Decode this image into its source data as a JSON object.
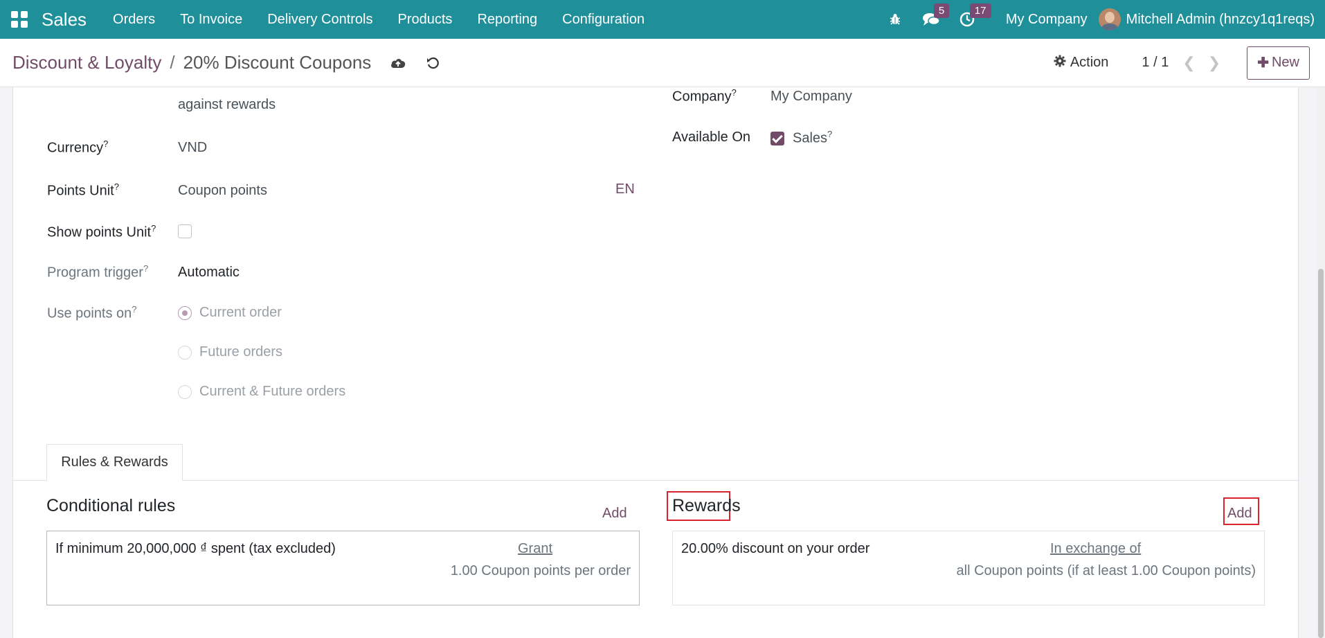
{
  "navbar": {
    "app_name": "Sales",
    "menu": [
      "Orders",
      "To Invoice",
      "Delivery Controls",
      "Products",
      "Reporting",
      "Configuration"
    ],
    "messages_count": "5",
    "activities_count": "17",
    "company": "My Company",
    "user": "Mitchell Admin (hnzcy1q1reqs)",
    "icons": [
      "apps-grid-icon",
      "bug-icon",
      "chat-icon",
      "clock-icon",
      "avatar"
    ]
  },
  "control_panel": {
    "breadcrumb_parent": "Discount & Loyalty",
    "breadcrumb_separator": "/",
    "breadcrumb_current": "20% Discount Coupons",
    "action_label": "Action",
    "pager": "1 / 1",
    "new_label": "New"
  },
  "form": {
    "truncated_text": "against rewards",
    "currency_label": "Currency",
    "currency_value": "VND",
    "points_unit_label": "Points Unit",
    "points_unit_value": "Coupon points",
    "lang": "EN",
    "show_points_label": "Show points Unit",
    "show_points_checked": false,
    "trigger_label": "Program trigger",
    "trigger_value": "Automatic",
    "use_points_label": "Use points on",
    "use_points_options": [
      "Current order",
      "Future orders",
      "Current & Future orders"
    ],
    "use_points_selected": "Current order",
    "help_mark": "?",
    "company_label": "Company",
    "company_value": "My Company",
    "available_on_label": "Available On",
    "available_on_value": "Sales",
    "available_on_checked": true
  },
  "notebook": {
    "tab": "Rules & Rewards",
    "rules_title": "Conditional rules",
    "rules_add": "Add",
    "rule_text": "If minimum 20,000,000 ₫ spent (tax excluded)",
    "rule_grant": "Grant",
    "rule_points": "1.00 Coupon points per order",
    "rewards_title": "Rewards",
    "rewards_add": "Add",
    "reward_text": "20.00% discount on your order",
    "reward_exchange": "In exchange of",
    "reward_points": "all Coupon points (if at least 1.00 Coupon points)"
  },
  "colors": {
    "navbar": "#1f8f9a",
    "accent": "#714b67",
    "highlight": "#d9232e"
  }
}
